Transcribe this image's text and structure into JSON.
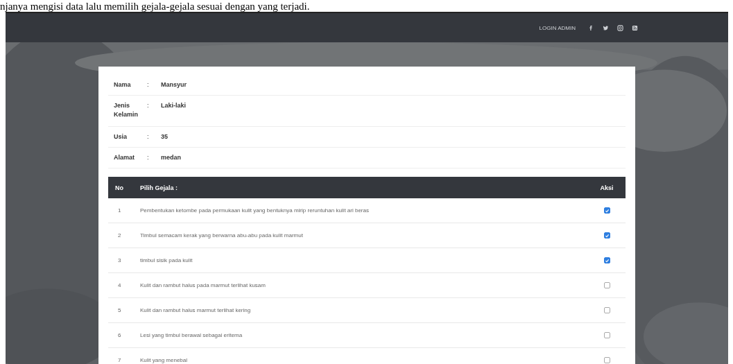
{
  "caption": "njanya mengisi data lalu memilih gejala-gejala sesuai dengan yang terjadi.",
  "nav": {
    "login": "LOGIN ADMIN"
  },
  "patient": [
    {
      "label": "Nama",
      "value": "Mansyur"
    },
    {
      "label": "Jenis Kelamin",
      "value": "Laki-laki"
    },
    {
      "label": "Usia",
      "value": "35"
    },
    {
      "label": "Alamat",
      "value": "medan"
    }
  ],
  "separator": ":",
  "table": {
    "columns": [
      "No",
      "Pilih Gejala :",
      "Aksi"
    ],
    "rows": [
      {
        "no": "1",
        "symptom": "Pembentukan ketombe pada permukaan kulit yang bentuknya mirip reruntuhan kulit ari beras",
        "checked": true
      },
      {
        "no": "2",
        "symptom": "Timbul semacam kerak yang berwarna abu-abu pada kulit marmut",
        "checked": true
      },
      {
        "no": "3",
        "symptom": "timbul sisik pada kulit",
        "checked": true
      },
      {
        "no": "4",
        "symptom": "Kulit dan rambut halus pada marmut terlihat kusam",
        "checked": false
      },
      {
        "no": "5",
        "symptom": "Kulit dan rambut halus marmut terlihat kering",
        "checked": false
      },
      {
        "no": "6",
        "symptom": "Lesi yang timbul berawal sebagai eritema",
        "checked": false
      },
      {
        "no": "7",
        "symptom": "Kulit yang menebal",
        "checked": false
      }
    ]
  }
}
